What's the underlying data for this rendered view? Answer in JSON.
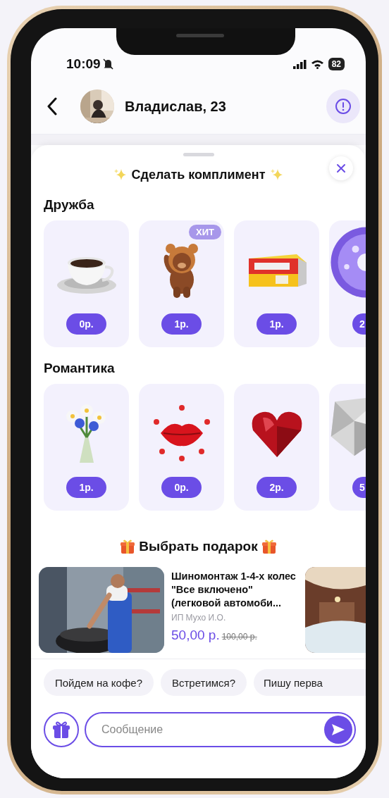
{
  "status_bar": {
    "time": "10:09",
    "battery": "82"
  },
  "chat_header": {
    "name": "Владислав, 23"
  },
  "compliment_sheet": {
    "title": "Сделать комплимент",
    "sections": [
      {
        "title": "Дружба",
        "items": [
          {
            "price": "0р."
          },
          {
            "price": "1р.",
            "badge": "ХИТ"
          },
          {
            "price": "1р."
          },
          {
            "price": "2"
          }
        ]
      },
      {
        "title": "Романтика",
        "items": [
          {
            "price": "1р."
          },
          {
            "price": "0р."
          },
          {
            "price": "2р."
          },
          {
            "price": "5"
          }
        ]
      }
    ]
  },
  "gift_section": {
    "title": "Выбрать подарок",
    "offers": [
      {
        "kind": "product",
        "title": "Шиномонтаж 1-4-х колес \"Все включено\" (легковой автомоби...",
        "seller": "ИП Мухо И.О.",
        "price": "50,00 р.",
        "old_price": "100,00 р."
      },
      {
        "kind": "picture"
      }
    ]
  },
  "quick_replies": [
    "Пойдем на кофе?",
    "Встретимся?",
    "Пишу перва"
  ],
  "composer": {
    "placeholder": "Сообщение"
  }
}
